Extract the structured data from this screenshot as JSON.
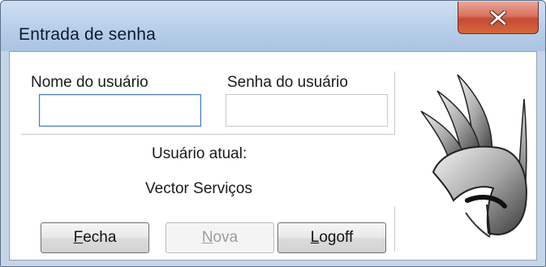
{
  "window": {
    "title": "Entrada de senha",
    "close_icon": "close-icon"
  },
  "form": {
    "username_label": "Nome  do usuário",
    "username_value": "",
    "password_label": "Senha do usuário",
    "password_value": ""
  },
  "status": {
    "label": "Usuário atual:",
    "value": "Vector Serviços"
  },
  "buttons": {
    "fecha": {
      "mnemonic": "F",
      "rest": "echa",
      "enabled": true
    },
    "nova": {
      "mnemonic": "N",
      "rest": "ova",
      "enabled": false
    },
    "logoff": {
      "mnemonic": "L",
      "rest": "ogoff",
      "enabled": true
    }
  },
  "logo": {
    "icon": "winged-helmet-logo"
  },
  "colors": {
    "titlebar": "#bcd2ec",
    "close_button": "#c74a34",
    "focus_border": "#3f7dc8"
  }
}
